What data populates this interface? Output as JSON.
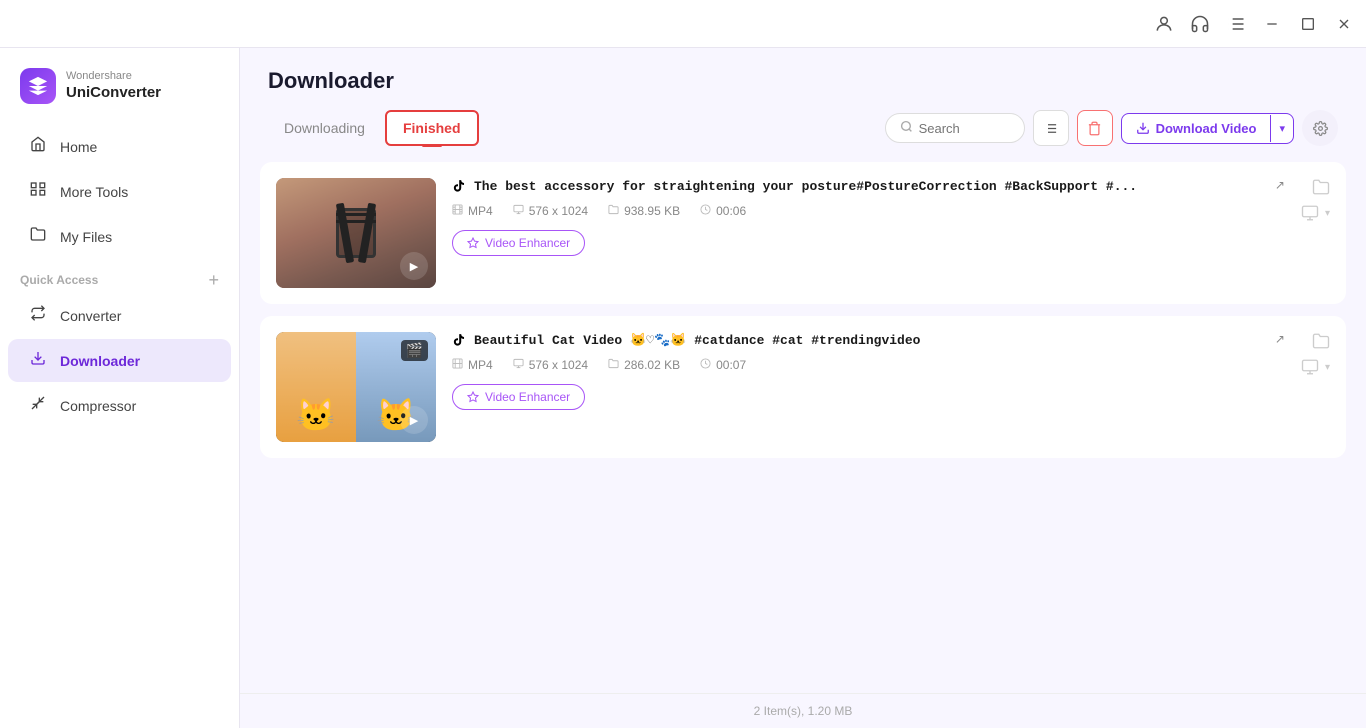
{
  "app": {
    "brand": "Wondershare",
    "name": "UniConverter"
  },
  "titlebar": {
    "icons": [
      "account",
      "headset",
      "list",
      "minimize",
      "maximize",
      "close"
    ]
  },
  "sidebar": {
    "nav_items": [
      {
        "id": "home",
        "label": "Home",
        "icon": "🏠",
        "active": false
      },
      {
        "id": "more-tools",
        "label": "More Tools",
        "icon": "🔧",
        "active": false
      },
      {
        "id": "my-files",
        "label": "My Files",
        "icon": "📁",
        "active": false
      }
    ],
    "quick_access_label": "Quick Access",
    "quick_access_items": [
      {
        "id": "converter",
        "label": "Converter",
        "icon": "⚙️",
        "active": false
      },
      {
        "id": "downloader",
        "label": "Downloader",
        "icon": "⬇️",
        "active": true
      },
      {
        "id": "compressor",
        "label": "Compressor",
        "icon": "🗜️",
        "active": false
      }
    ]
  },
  "page": {
    "title": "Downloader",
    "tabs": [
      {
        "id": "downloading",
        "label": "Downloading",
        "active": false
      },
      {
        "id": "finished",
        "label": "Finished",
        "active": true
      }
    ],
    "search": {
      "placeholder": "Search"
    },
    "download_video_label": "Download Video"
  },
  "videos": [
    {
      "id": "v1",
      "source": "tiktok",
      "title": "The best accessory for straightening your posture#PostureCorrection #BackSupport #...",
      "format": "MP4",
      "resolution": "576 x 1024",
      "size": "938.95 KB",
      "duration": "00:06",
      "thumb_type": "posture",
      "enhancer_label": "Video Enhancer"
    },
    {
      "id": "v2",
      "source": "tiktok",
      "title": "Beautiful Cat Video 🐱♡🐾🐱 #catdance  #cat  #trendingvideo",
      "format": "MP4",
      "resolution": "576 x 1024",
      "size": "286.02 KB",
      "duration": "00:07",
      "thumb_type": "cats",
      "enhancer_label": "Video Enhancer"
    }
  ],
  "status_bar": {
    "text": "2 Item(s), 1.20 MB"
  }
}
